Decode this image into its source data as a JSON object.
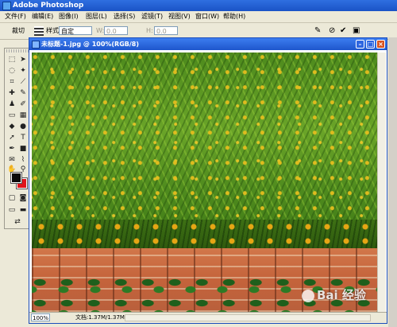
{
  "app": {
    "title": "Adobe Photoshop"
  },
  "menu": [
    "文件(F)",
    "编辑(E)",
    "图像(I)",
    "图层(L)",
    "选择(S)",
    "滤镜(T)",
    "视图(V)",
    "窗口(W)",
    "帮助(H)"
  ],
  "options": {
    "tool_label": "裁切",
    "style_label": "样式:",
    "style_value": "自定",
    "width_label": "W:",
    "width_value": "0.0",
    "height_label": "H:",
    "height_value": "0.0"
  },
  "document": {
    "title": "未标题-1.jpg @ 100%(RGB/8)",
    "zoom": "100%",
    "doc_size": "文档:1.37M/1.37M"
  },
  "colors": {
    "foreground": "#0b0b0b",
    "background": "#e0141b"
  },
  "watermark": {
    "text": "Bai 经验"
  }
}
